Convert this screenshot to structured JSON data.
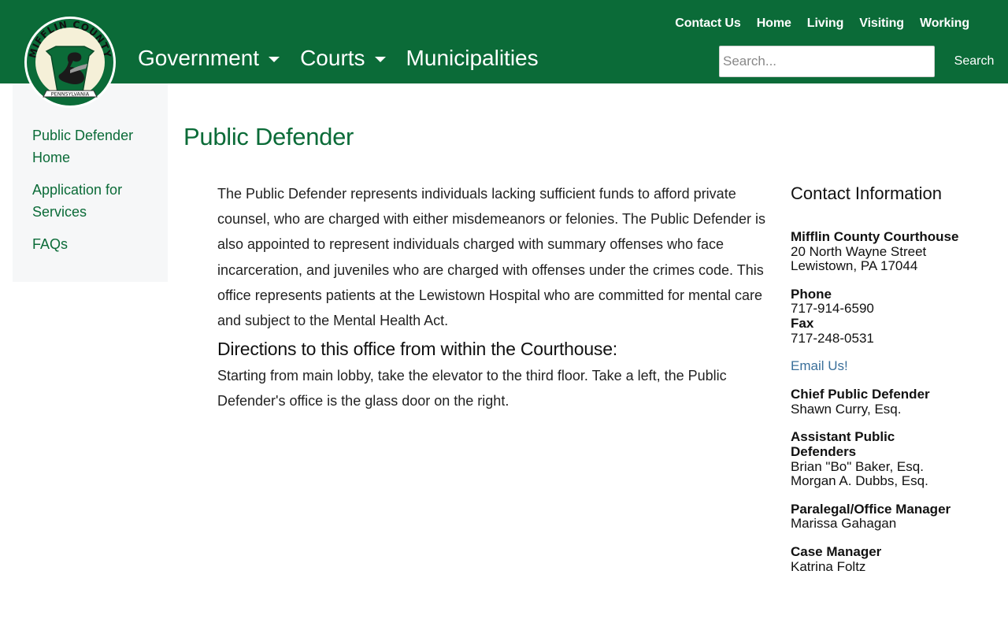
{
  "header": {
    "logo": {
      "top_text": "MIFFLIN COUNTY",
      "banner_text": "PENNSYLVANIA"
    },
    "top_links": [
      "Contact Us",
      "Home",
      "Living",
      "Visiting",
      "Working"
    ],
    "nav": {
      "government": "Government",
      "courts": "Courts",
      "municipalities": "Municipalities"
    },
    "search": {
      "placeholder": "Search...",
      "button_label": "Search"
    }
  },
  "sidebar": {
    "items": [
      {
        "label": "Public Defender Home"
      },
      {
        "label": "Application for Services"
      },
      {
        "label": "FAQs"
      }
    ]
  },
  "main": {
    "title": "Public Defender",
    "intro": "The Public Defender represents individuals lacking sufficient funds to afford private counsel, who are charged with either misdemeanors or felonies. The Public Defender is also appointed to represent individuals charged with summary offenses who face incarceration, and juveniles who are charged with offenses under the crimes code. This office represents patients at the Lewistown Hospital who are committed for mental care and subject to the Mental Health Act.",
    "directions_heading": "Directions to this office from within the Courthouse:",
    "directions_text": "Starting from main lobby, take the elevator to the third floor.  Take a left, the Public Defender's office is the glass door on the right."
  },
  "contact": {
    "title": "Contact Information",
    "location_label": "Mifflin County Courthouse",
    "address_line1": "20 North Wayne Street",
    "address_line2": "Lewistown, PA 17044",
    "phone_label": "Phone",
    "phone": "717-914-6590",
    "fax_label": "Fax",
    "fax": "717-248-0531",
    "email_link": "Email Us!",
    "chief_label": "Chief Public Defender",
    "chief_name": "Shawn Curry, Esq.",
    "assistants_label": "Assistant Public Defenders",
    "assistant1": "Brian \"Bo\" Baker, Esq.",
    "assistant2": "Morgan A. Dubbs, Esq.",
    "paralegal_label": "Paralegal/Office Manager",
    "paralegal_name": "Marissa Gahagan",
    "case_manager_label": "Case Manager",
    "case_manager_name": "Katrina Foltz"
  },
  "colors": {
    "brand_green": "#0b6b38",
    "link_blue": "#3a6f9a",
    "sidebar_bg": "#f6f7f8"
  }
}
